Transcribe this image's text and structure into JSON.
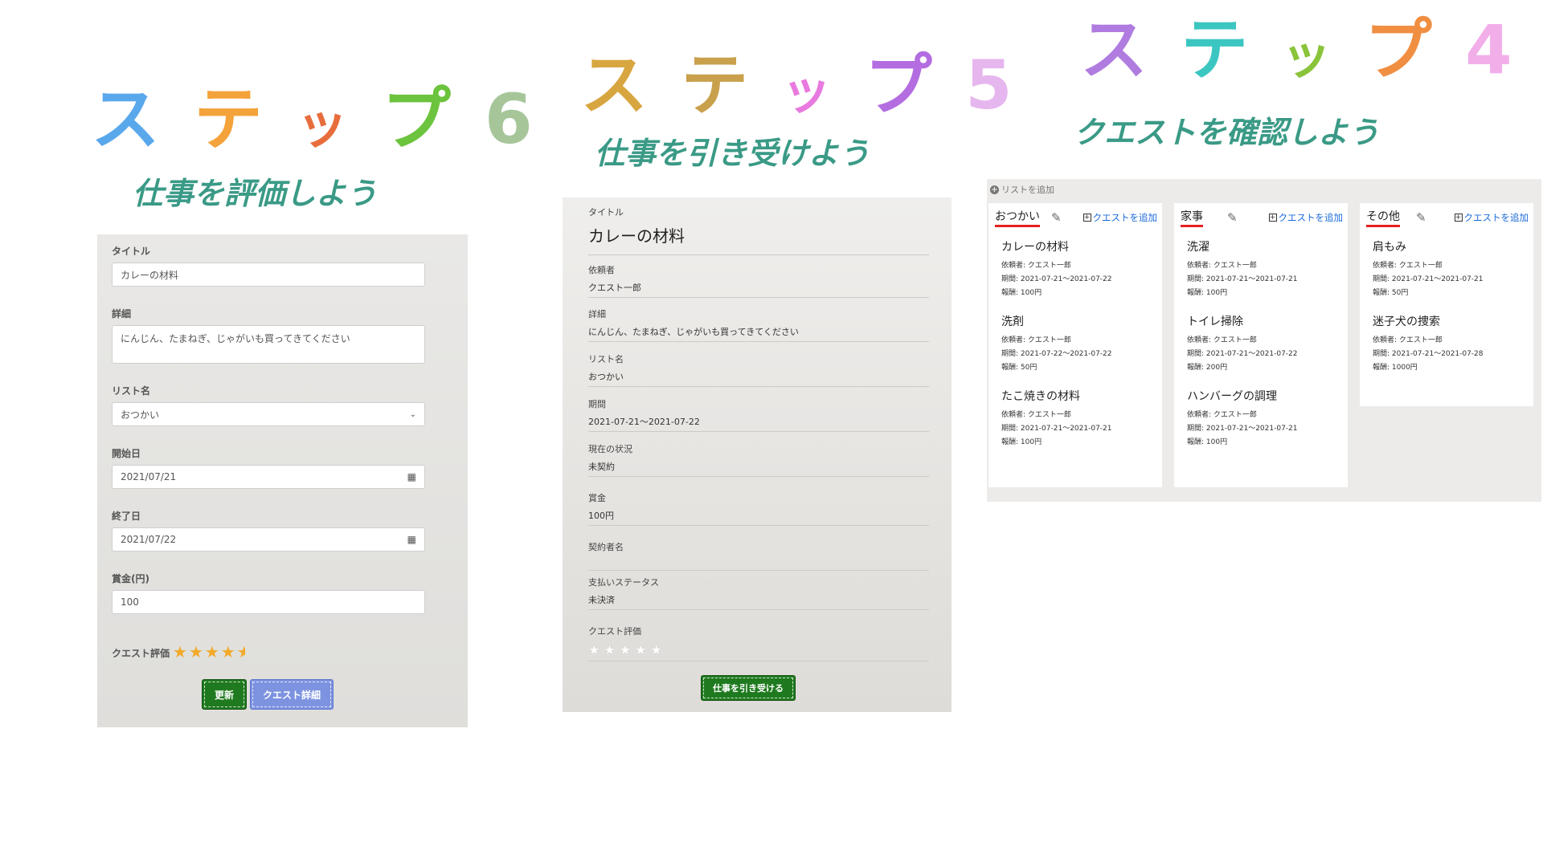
{
  "steps": {
    "step6": {
      "title_chars": [
        "ス",
        "テ",
        "ッ",
        "プ",
        "6"
      ],
      "subtitle": "仕事を評価しよう"
    },
    "step5": {
      "title_chars": [
        "ス",
        "テ",
        "ッ",
        "プ",
        "5"
      ],
      "subtitle": "仕事を引き受けよう"
    },
    "step4": {
      "title_chars": [
        "ス",
        "テ",
        "ッ",
        "プ",
        "4"
      ],
      "subtitle": "クエストを確認しよう"
    }
  },
  "colors": {
    "step6": [
      "#5aa8ec",
      "#f4a23a",
      "#e86d3c",
      "#6cc33d",
      "#a6c69a"
    ],
    "step5": [
      "#d8a640",
      "#c9a04c",
      "#e87adf",
      "#b36de0",
      "#e6b6ef"
    ],
    "step4": [
      "#b07ce0",
      "#3cc6c1",
      "#8ac43a",
      "#f08e42",
      "#f2aee9"
    ],
    "accent_green": "#1f7a1f",
    "accent_blue": "#7d93e0",
    "link_blue": "#1a6ad9",
    "underline_red": "#e52020",
    "subtitle_teal": "#3a9a86"
  },
  "evaluate_form": {
    "title_label": "タイトル",
    "title_value": "カレーの材料",
    "detail_label": "詳細",
    "detail_value": "にんじん、たまねぎ、じゃがいも買ってきてください",
    "list_label": "リスト名",
    "list_value": "おつかい",
    "start_label": "開始日",
    "start_value": "2021/07/21",
    "end_label": "終了日",
    "end_value": "2021/07/22",
    "reward_label": "賞金(円)",
    "reward_value": "100",
    "rating_label": "クエスト評価",
    "rating_value": 4.5,
    "rating_max": 5,
    "update_button": "更新",
    "detail_button": "クエスト詳細"
  },
  "accept_details": {
    "title_label": "タイトル",
    "title_value": "カレーの材料",
    "requester_label": "依頼者",
    "requester_value": "クエスト一郎",
    "detail_label": "詳細",
    "detail_value": "にんじん、たまねぎ、じゃがいも買ってきてください",
    "list_label": "リスト名",
    "list_value": "おつかい",
    "period_label": "期間",
    "period_value": "2021-07-21〜2021-07-22",
    "status_label": "現在の状況",
    "status_value": "未契約",
    "reward_label": "賞金",
    "reward_value": "100円",
    "contractor_label": "契約者名",
    "contractor_value": "",
    "payment_label": "支払いステータス",
    "payment_value": "未決済",
    "rating_label": "クエスト評価",
    "rating_value": 0,
    "accept_button": "仕事を引き受ける"
  },
  "board": {
    "add_list_label": "リストを追加",
    "add_quest_label": "クエストを追加",
    "lists": [
      {
        "name": "おつかい",
        "quests": [
          {
            "title": "カレーの材料",
            "requester": "依頼者: クエスト一郎",
            "period": "期間: 2021-07-21〜2021-07-22",
            "reward": "報酬: 100円"
          },
          {
            "title": "洗剤",
            "requester": "依頼者: クエスト一郎",
            "period": "期間: 2021-07-22〜2021-07-22",
            "reward": "報酬: 50円"
          },
          {
            "title": "たこ焼きの材料",
            "requester": "依頼者: クエスト一郎",
            "period": "期間: 2021-07-21〜2021-07-21",
            "reward": "報酬: 100円"
          }
        ]
      },
      {
        "name": "家事",
        "quests": [
          {
            "title": "洗濯",
            "requester": "依頼者: クエスト一郎",
            "period": "期間: 2021-07-21〜2021-07-21",
            "reward": "報酬: 100円"
          },
          {
            "title": "トイレ掃除",
            "requester": "依頼者: クエスト一郎",
            "period": "期間: 2021-07-21〜2021-07-22",
            "reward": "報酬: 200円"
          },
          {
            "title": "ハンバーグの調理",
            "requester": "依頼者: クエスト一郎",
            "period": "期間: 2021-07-21〜2021-07-21",
            "reward": "報酬: 100円"
          }
        ]
      },
      {
        "name": "その他",
        "quests": [
          {
            "title": "肩もみ",
            "requester": "依頼者: クエスト一郎",
            "period": "期間: 2021-07-21〜2021-07-21",
            "reward": "報酬: 50円"
          },
          {
            "title": "迷子犬の捜索",
            "requester": "依頼者: クエスト一郎",
            "period": "期間: 2021-07-21〜2021-07-28",
            "reward": "報酬: 1000円"
          }
        ]
      }
    ]
  }
}
